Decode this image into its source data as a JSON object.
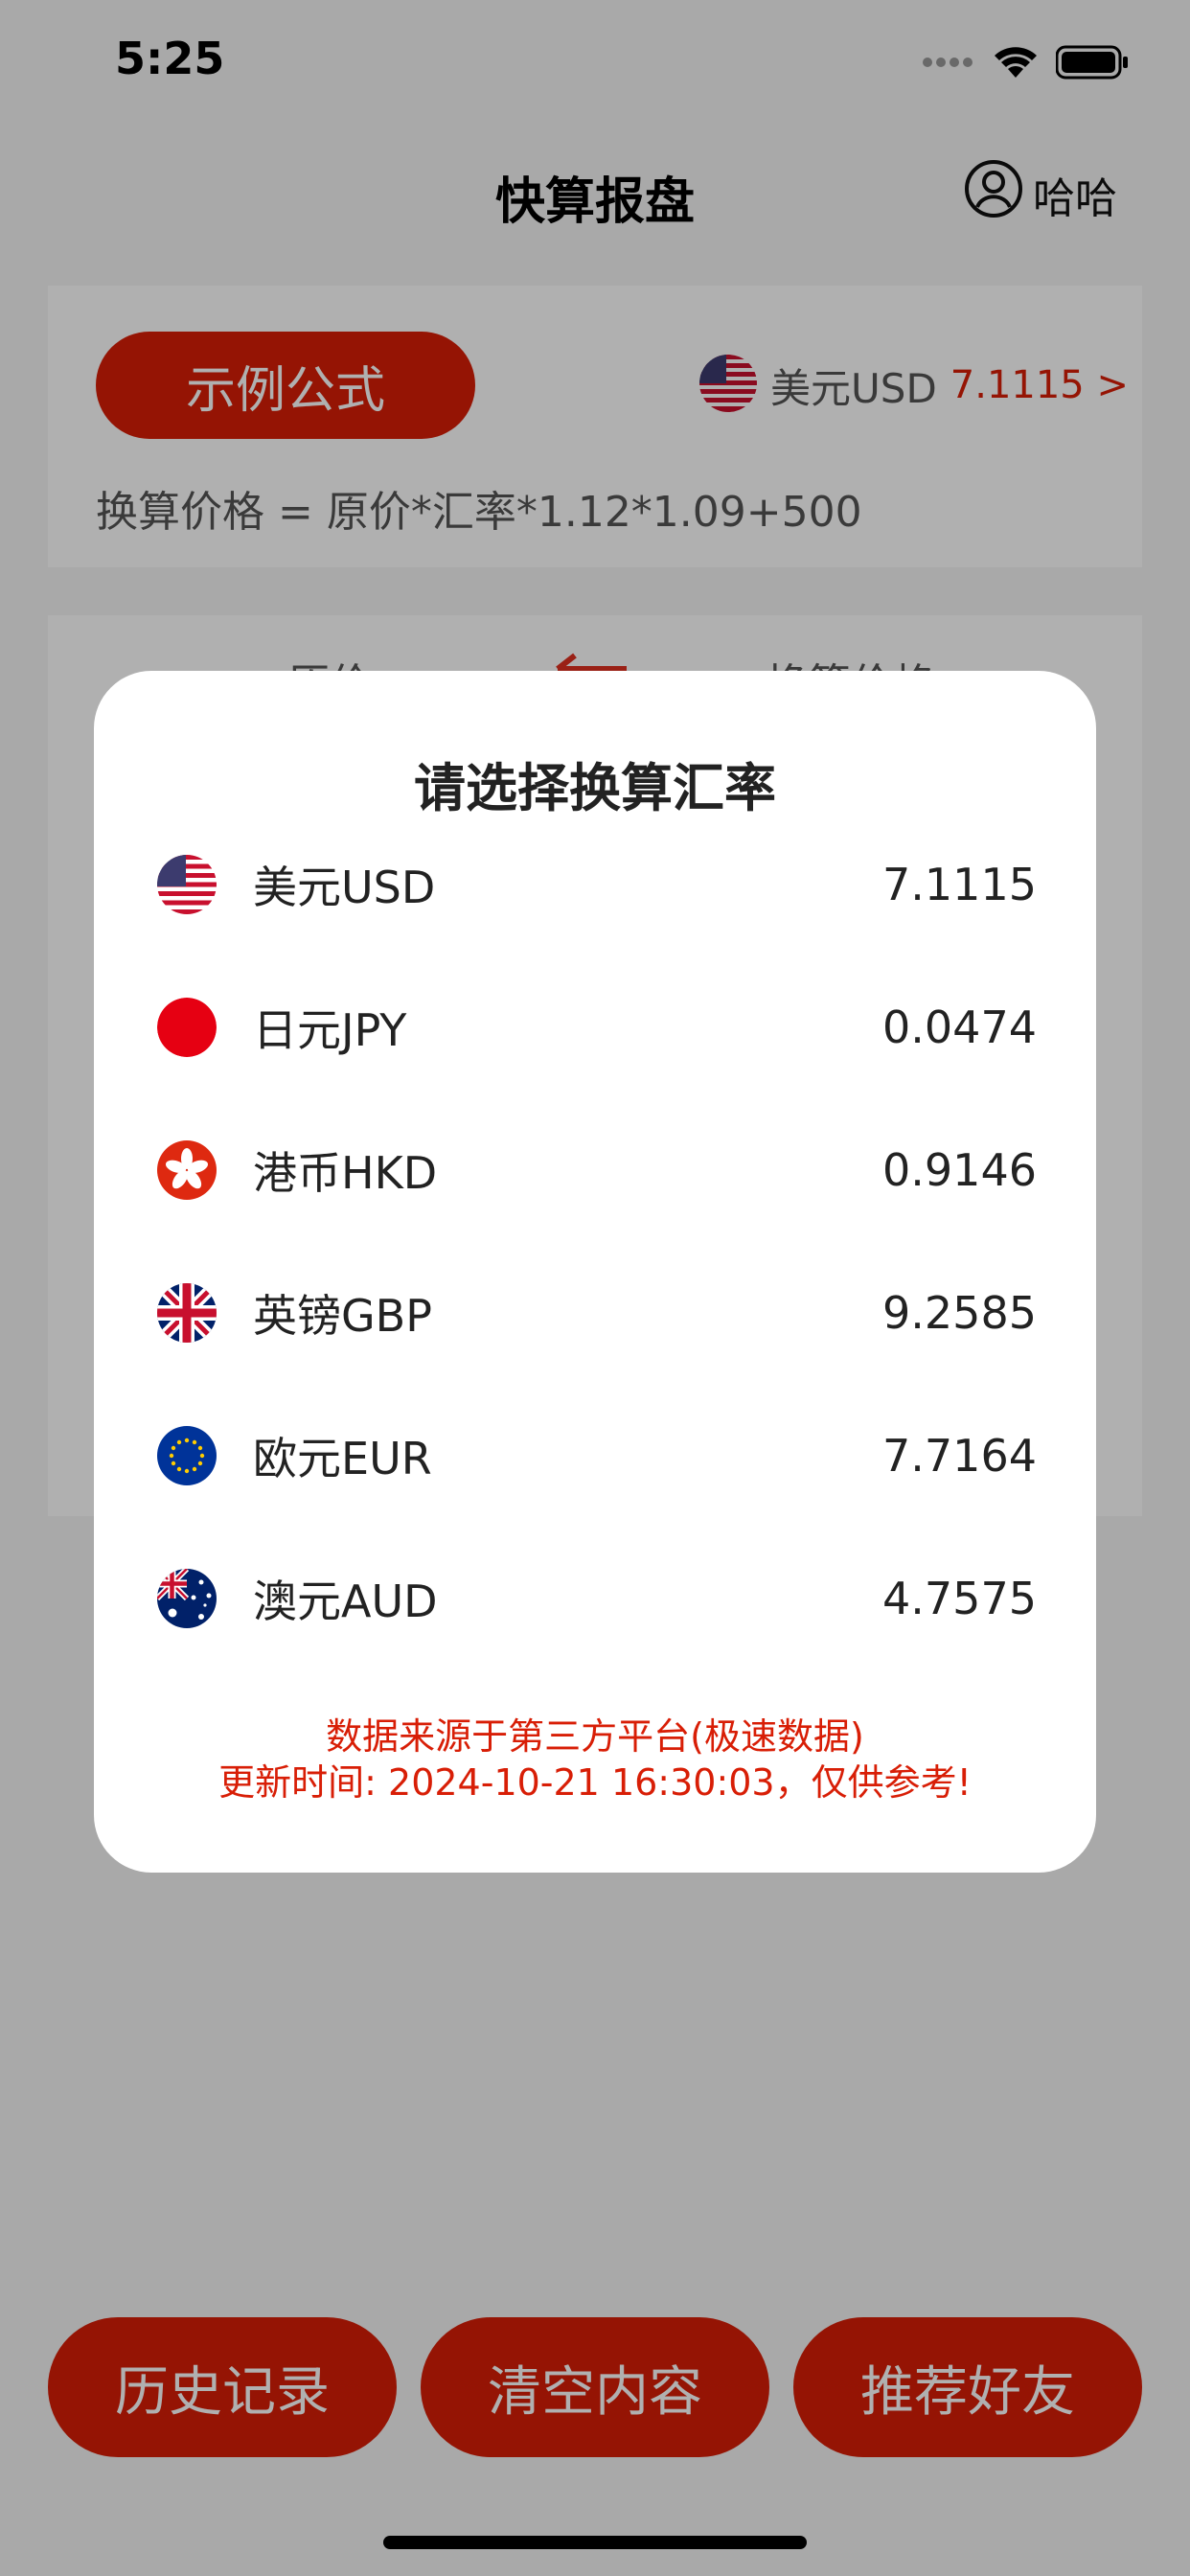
{
  "status_bar": {
    "time": "5:25",
    "icons": [
      "signal-icon",
      "wifi-icon",
      "battery-icon"
    ]
  },
  "nav": {
    "title": "快算报盘",
    "user_name": "哈哈",
    "user_icon": "user-icon"
  },
  "formula_card": {
    "example_button": "示例公式",
    "selected_currency": "美元USD",
    "selected_rate": "7.1115 >",
    "formula": "换算价格 = 原价*汇率*1.12*1.09+500"
  },
  "calc_card": {
    "left_header": "原价",
    "right_header": "换算价格"
  },
  "bottom_buttons": {
    "history": "历史记录",
    "clear": "清空内容",
    "recommend": "推荐好友"
  },
  "dialog": {
    "title": "请选择换算汇率",
    "rates": [
      {
        "name": "美元USD",
        "value": "7.1115",
        "flag": "us-flag-icon"
      },
      {
        "name": "日元JPY",
        "value": "0.0474",
        "flag": "jp-flag-icon"
      },
      {
        "name": "港币HKD",
        "value": "0.9146",
        "flag": "hk-flag-icon"
      },
      {
        "name": "英镑GBP",
        "value": "9.2585",
        "flag": "uk-flag-icon"
      },
      {
        "name": "欧元EUR",
        "value": "7.7164",
        "flag": "eu-flag-icon"
      },
      {
        "name": "澳元AUD",
        "value": "4.7575",
        "flag": "au-flag-icon"
      }
    ],
    "note_line1": "数据来源于第三方平台(极速数据)",
    "note_line2": "更新时间: 2024-10-21 16:30:03，仅供参考!"
  },
  "colors": {
    "accent": "#d81e06",
    "overlay": "rgba(0,0,0,0.31)"
  }
}
